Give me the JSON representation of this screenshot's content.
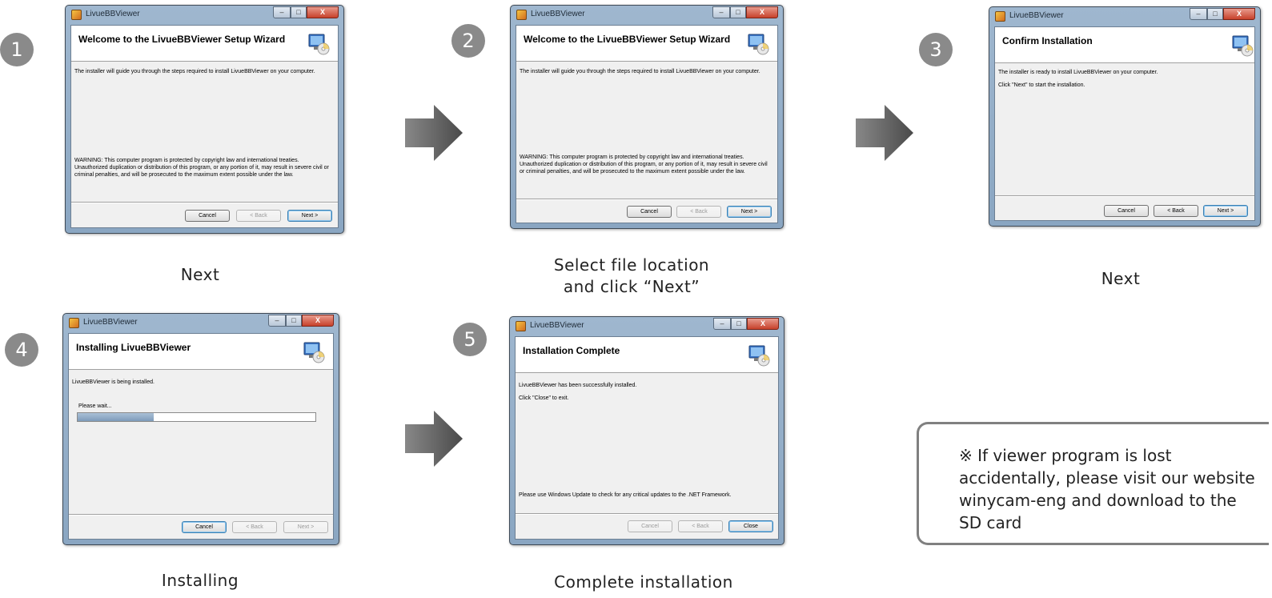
{
  "steps": [
    {
      "number": "1",
      "caption": "Next",
      "window": {
        "title": "LivueBBViewer",
        "heading": "Welcome to the LivueBBViewer Setup Wizard",
        "body": [
          "The installer will guide you through the steps required to install LivueBBViewer on your computer."
        ],
        "warning": "WARNING: This computer program is protected by copyright law and international treaties. Unauthorized duplication or distribution of this program, or any portion of it, may result in severe civil or criminal penalties, and will be prosecuted to the maximum extent possible under the law.",
        "buttons": [
          "Cancel",
          "< Back",
          "Next >"
        ]
      }
    },
    {
      "number": "2",
      "caption": "Select file location\nand click “Next”",
      "window": {
        "title": "LivueBBViewer",
        "heading": "Welcome to the LivueBBViewer Setup Wizard",
        "body": [
          "The installer will guide you through the steps required to install LivueBBViewer on your computer."
        ],
        "warning": "WARNING: This computer program is protected by copyright law and international treaties. Unauthorized duplication or distribution of this program, or any portion of it, may result in severe civil or criminal penalties, and will be prosecuted to the maximum extent possible under the law.",
        "buttons": [
          "Cancel",
          "< Back",
          "Next >"
        ]
      }
    },
    {
      "number": "3",
      "caption": "Next",
      "window": {
        "title": "LivueBBViewer",
        "heading": "Confirm Installation",
        "body": [
          "The installer is ready to install LivueBBViewer on your computer.",
          "Click \"Next\" to start the installation."
        ],
        "buttons": [
          "Cancel",
          "< Back",
          "Next >"
        ]
      }
    },
    {
      "number": "4",
      "caption": "Installing",
      "window": {
        "title": "LivueBBViewer",
        "heading": "Installing LivueBBViewer",
        "body": [
          "LivueBBViewer is being installed."
        ],
        "progress_label": "Please wait...",
        "progress": 0.32,
        "buttons": [
          "Cancel",
          "< Back",
          "Next >"
        ]
      }
    },
    {
      "number": "5",
      "caption": "Complete installation",
      "window": {
        "title": "LivueBBViewer",
        "heading": "Installation Complete",
        "body": [
          "LivueBBViewer has been successfully installed.",
          "Click \"Close\" to exit."
        ],
        "warning": "Please use Windows Update to check for any critical updates to the .NET Framework.",
        "buttons": [
          "Cancel",
          "< Back",
          "Close"
        ]
      }
    }
  ],
  "window_controls": {
    "minimize": "–",
    "maximize": "□",
    "close": "X"
  },
  "note": "※ If viewer program is lost accidentally, please visit our website winycam-eng and download to the SD card",
  "colors": {
    "badge": "#8a8a8a",
    "arrow": "#5a5a5a",
    "window_frame": "#9fb7cf"
  },
  "icons": {
    "step_arrow": "right-arrow-icon",
    "installer": "setup-computer-icon",
    "app": "app-icon"
  }
}
